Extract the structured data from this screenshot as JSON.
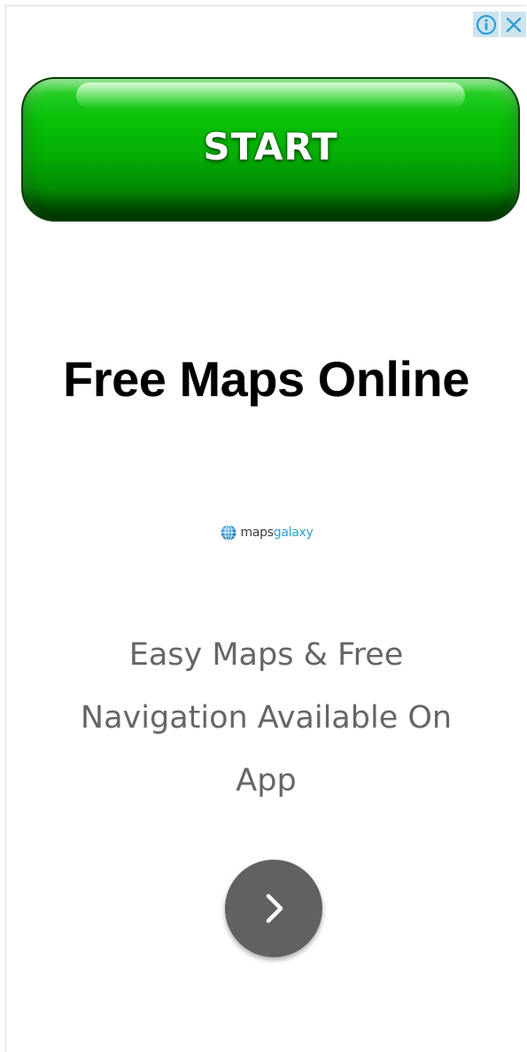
{
  "ad": {
    "cta_label": "START",
    "headline": "Free Maps Online",
    "brand": {
      "name_part1": "maps",
      "name_part2": "galaxy",
      "icon": "globe-icon",
      "color_part1": "#3a3a3a",
      "color_part2": "#2a9fd8"
    },
    "description": "Easy Maps & Free Navigation Available On App",
    "next_icon": "chevron-right-icon"
  },
  "adchoices": {
    "info_icon": "info-icon",
    "close_icon": "close-icon",
    "accent": "#2a9fd8"
  },
  "colors": {
    "cta_green": "#08c108",
    "headline": "#000000",
    "description": "#666666",
    "next_button": "#616161"
  }
}
